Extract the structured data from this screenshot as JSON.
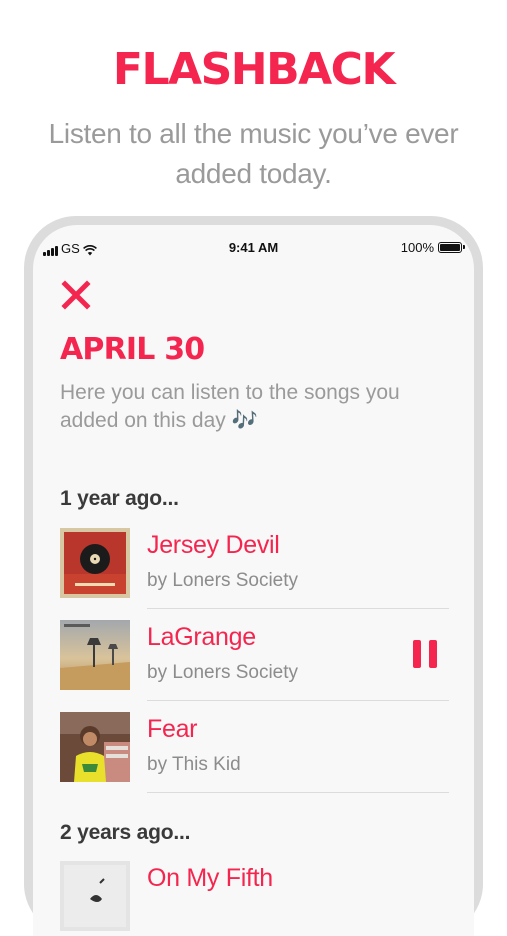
{
  "hero": {
    "title": "FLASHBACK",
    "subtitle": "Listen to all the music you’ve ever added today."
  },
  "status_bar": {
    "carrier": "GS",
    "time": "9:41 AM",
    "battery": "100%"
  },
  "screen": {
    "date_title": "APRIL 30",
    "description": "Here you can listen to the songs you added on this day 🎶"
  },
  "sections": [
    {
      "header": "1 year ago...",
      "songs": [
        {
          "title": "Jersey Devil",
          "artist": "by Loners Society"
        },
        {
          "title": "LaGrange",
          "artist": "by Loners Society",
          "playing": true
        },
        {
          "title": "Fear",
          "artist": "by This Kid"
        }
      ]
    },
    {
      "header": "2 years ago...",
      "songs": [
        {
          "title": "On My Fifth",
          "artist": ""
        }
      ]
    }
  ],
  "icons": {
    "close": "close-icon",
    "pause": "pause-icon",
    "wifi": "wifi-icon",
    "signal": "signal-icon",
    "battery": "battery-icon"
  },
  "colors": {
    "accent": "#f4264f",
    "secondary_text": "#9a9a9a",
    "section_text": "#3a3a3a"
  }
}
